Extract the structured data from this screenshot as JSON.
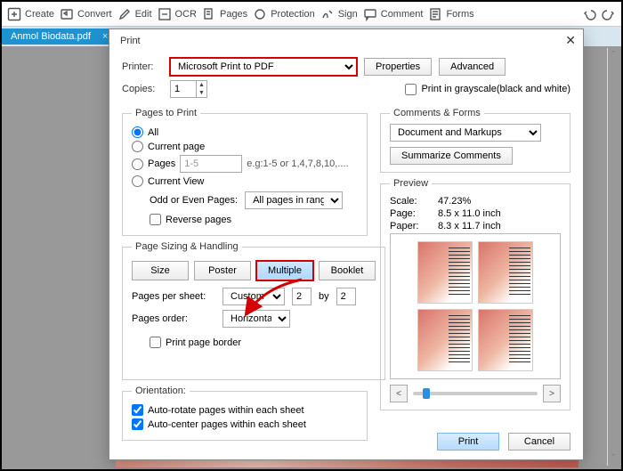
{
  "toolbar": {
    "create": "Create",
    "convert": "Convert",
    "edit": "Edit",
    "ocr": "OCR",
    "pages": "Pages",
    "protection": "Protection",
    "sign": "Sign",
    "comment": "Comment",
    "forms": "Forms"
  },
  "tab": {
    "label": "Anmol Biodata.pdf"
  },
  "dialog": {
    "title": "Print",
    "printer_lbl": "Printer:",
    "printer_value": "Microsoft Print to PDF",
    "properties": "Properties",
    "advanced": "Advanced",
    "copies_lbl": "Copies:",
    "copies_value": "1",
    "grayscale": "Print in grayscale(black and white)",
    "pages_to_print": {
      "legend": "Pages to Print",
      "all": "All",
      "current": "Current page",
      "pages": "Pages",
      "pages_val": "1-5",
      "pages_hint": "e.g:1-5 or 1,4,7,8,10,....",
      "currentview": "Current View",
      "oddeven_lbl": "Odd or Even Pages:",
      "oddeven_val": "All pages in range",
      "reverse": "Reverse pages"
    },
    "sizing": {
      "legend": "Page Sizing & Handling",
      "size": "Size",
      "poster": "Poster",
      "multiple": "Multiple",
      "booklet": "Booklet",
      "pps_lbl": "Pages per sheet:",
      "pps_mode": "Custom Sc",
      "pps_cols": "2",
      "pps_by": "by",
      "pps_rows": "2",
      "order_lbl": "Pages order:",
      "order_val": "Horizontal",
      "border": "Print page border"
    },
    "orientation": {
      "legend": "Orientation:",
      "auto_rotate": "Auto-rotate pages within each sheet",
      "auto_center": "Auto-center pages within each sheet"
    },
    "comments": {
      "legend": "Comments & Forms",
      "mode": "Document and Markups",
      "summarize": "Summarize Comments"
    },
    "preview": {
      "legend": "Preview",
      "scale_k": "Scale:",
      "scale_v": "47.23%",
      "page_k": "Page:",
      "page_v": "8.5 x 11.0 inch",
      "paper_k": "Paper:",
      "paper_v": "8.3 x 11.7 inch"
    },
    "print": "Print",
    "cancel": "Cancel"
  }
}
